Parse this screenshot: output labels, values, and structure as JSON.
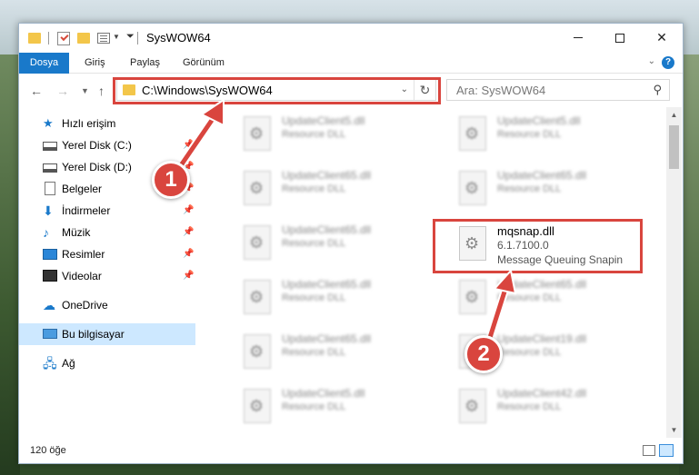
{
  "window": {
    "title": "SysWOW64"
  },
  "ribbon": {
    "tabs": [
      "Dosya",
      "Giriş",
      "Paylaş",
      "Görünüm"
    ],
    "help": "?"
  },
  "address": {
    "path": "C:\\Windows\\SysWOW64",
    "search_placeholder": "Ara: SysWOW64"
  },
  "sidebar": {
    "items": [
      {
        "label": "Hızlı erişim",
        "icon": "star-icon"
      },
      {
        "label": "Yerel Disk (C:)",
        "icon": "drive-icon",
        "pinned": true
      },
      {
        "label": "Yerel Disk (D:)",
        "icon": "drive-icon",
        "pinned": true
      },
      {
        "label": "Belgeler",
        "icon": "document-icon",
        "pinned": true
      },
      {
        "label": "İndirmeler",
        "icon": "download-icon",
        "pinned": true
      },
      {
        "label": "Müzik",
        "icon": "music-icon",
        "pinned": true
      },
      {
        "label": "Resimler",
        "icon": "pictures-icon",
        "pinned": true
      },
      {
        "label": "Videolar",
        "icon": "video-icon",
        "pinned": true
      },
      {
        "label": "OneDrive",
        "icon": "cloud-icon"
      },
      {
        "label": "Bu bilgisayar",
        "icon": "computer-icon",
        "selected": true
      },
      {
        "label": "Ağ",
        "icon": "network-icon"
      }
    ]
  },
  "files": {
    "left": [
      {
        "name": "UpdateClient5.dll",
        "sub": "Resource DLL"
      },
      {
        "name": "UpdateClient65.dll",
        "sub": "Resource DLL"
      },
      {
        "name": "UpdateClient65.dll",
        "sub": "Resource DLL"
      },
      {
        "name": "UpdateClient65.dll",
        "sub": "Resource DLL"
      },
      {
        "name": "UpdateClient65.dll",
        "sub": "Resource DLL"
      },
      {
        "name": "UpdateClient5.dll",
        "sub": "Resource DLL"
      }
    ],
    "right": [
      {
        "name": "UpdateClient5.dll",
        "sub": "Resource DLL"
      },
      {
        "name": "UpdateClient65.dll",
        "sub": "Resource DLL"
      },
      {
        "name": "UpdateClient65.dll",
        "sub": "Resource DLL"
      },
      {
        "name": "UpdateClient19.dll",
        "sub": "Resource DLL"
      },
      {
        "name": "UpdateClient42.dll",
        "sub": "Resource DLL"
      }
    ],
    "highlighted": {
      "name": "mqsnap.dll",
      "version": "6.1.7100.0",
      "description": "Message Queuing Snapin"
    }
  },
  "status": {
    "count": "120 öğe"
  },
  "callouts": [
    "1",
    "2"
  ],
  "colors": {
    "accent": "#1979ca",
    "highlight": "#d9453e",
    "selected": "#cde8ff"
  }
}
